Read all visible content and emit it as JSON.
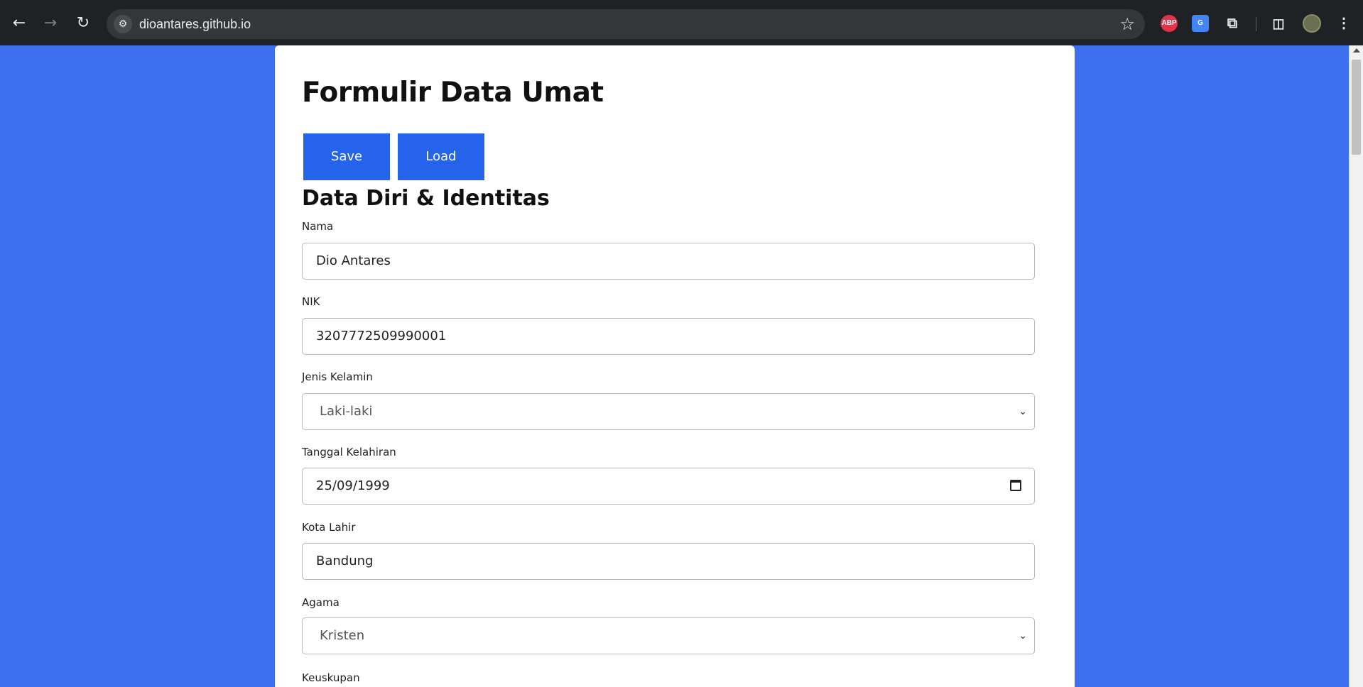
{
  "browser": {
    "url": "dioantares.github.io",
    "abp_label": "ABP"
  },
  "form": {
    "title": "Formulir Data Umat",
    "save_label": "Save",
    "load_label": "Load",
    "section_title": "Data Diri & Identitas",
    "fields": [
      {
        "label": "Nama",
        "value": "Dio Antares",
        "type": "text"
      },
      {
        "label": "NIK",
        "value": "3207772509990001",
        "type": "text"
      },
      {
        "label": "Jenis Kelamin",
        "value": "Laki-laki",
        "type": "select"
      },
      {
        "label": "Tanggal Kelahiran",
        "value": "25/09/1999",
        "type": "date"
      },
      {
        "label": "Kota Lahir",
        "value": "Bandung",
        "type": "text"
      },
      {
        "label": "Agama",
        "value": "Kristen",
        "type": "select"
      },
      {
        "label": "Keuskupan",
        "value": "",
        "type": "select"
      }
    ]
  },
  "icons": {
    "back": "arrow-left-icon",
    "forward": "arrow-right-icon",
    "reload": "reload-icon",
    "site_info": "tune-icon",
    "bookmark": "star-icon",
    "extensions": "puzzle-icon",
    "side_panel": "side-panel-icon",
    "menu": "kebab-menu-icon",
    "dropdown": "chevron-down-icon",
    "calendar": "calendar-icon"
  },
  "colors": {
    "page_background": "#3d6ff0",
    "button": "#2563eb",
    "browser_chrome": "#202124"
  }
}
